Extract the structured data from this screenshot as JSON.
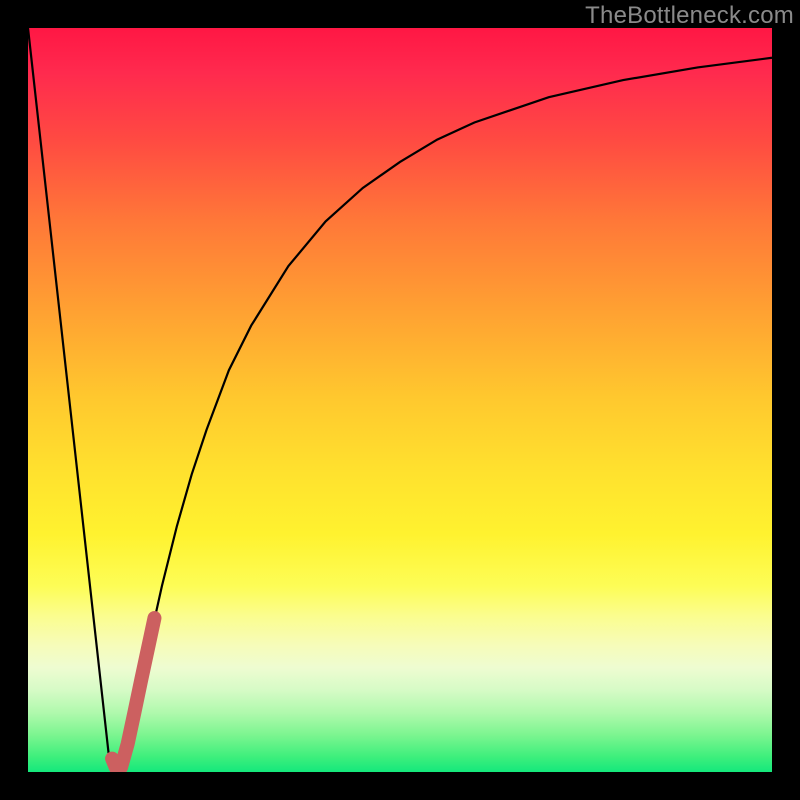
{
  "watermark": "TheBottleneck.com",
  "colors": {
    "frame": "#000000",
    "curve": "#000000",
    "highlight": "#cc6060",
    "gradient_top": "#ff1744",
    "gradient_bottom": "#14e87c"
  },
  "chart_data": {
    "type": "line",
    "title": "",
    "xlabel": "",
    "ylabel": "",
    "xlim": [
      0,
      100
    ],
    "ylim": [
      0,
      100
    ],
    "series": [
      {
        "name": "bottleneck-curve",
        "x": [
          0,
          2,
          4,
          6,
          8,
          10,
          11,
          12,
          13,
          14,
          16,
          18,
          20,
          22,
          24,
          27,
          30,
          35,
          40,
          45,
          50,
          55,
          60,
          70,
          80,
          90,
          100
        ],
        "y": [
          100,
          82,
          64,
          46,
          28,
          10,
          1,
          0,
          1,
          6,
          16,
          25,
          33,
          40,
          46,
          54,
          60,
          68,
          74,
          78.5,
          82,
          85,
          87.3,
          90.7,
          93,
          94.7,
          96
        ]
      },
      {
        "name": "optimal-highlight",
        "x": [
          11.3,
          11.8,
          12.5,
          13.4,
          14.3,
          15.2,
          16.1,
          17.0
        ],
        "y": [
          1.8,
          0.6,
          0.6,
          3.8,
          8.0,
          12.3,
          16.5,
          20.7
        ]
      }
    ]
  }
}
